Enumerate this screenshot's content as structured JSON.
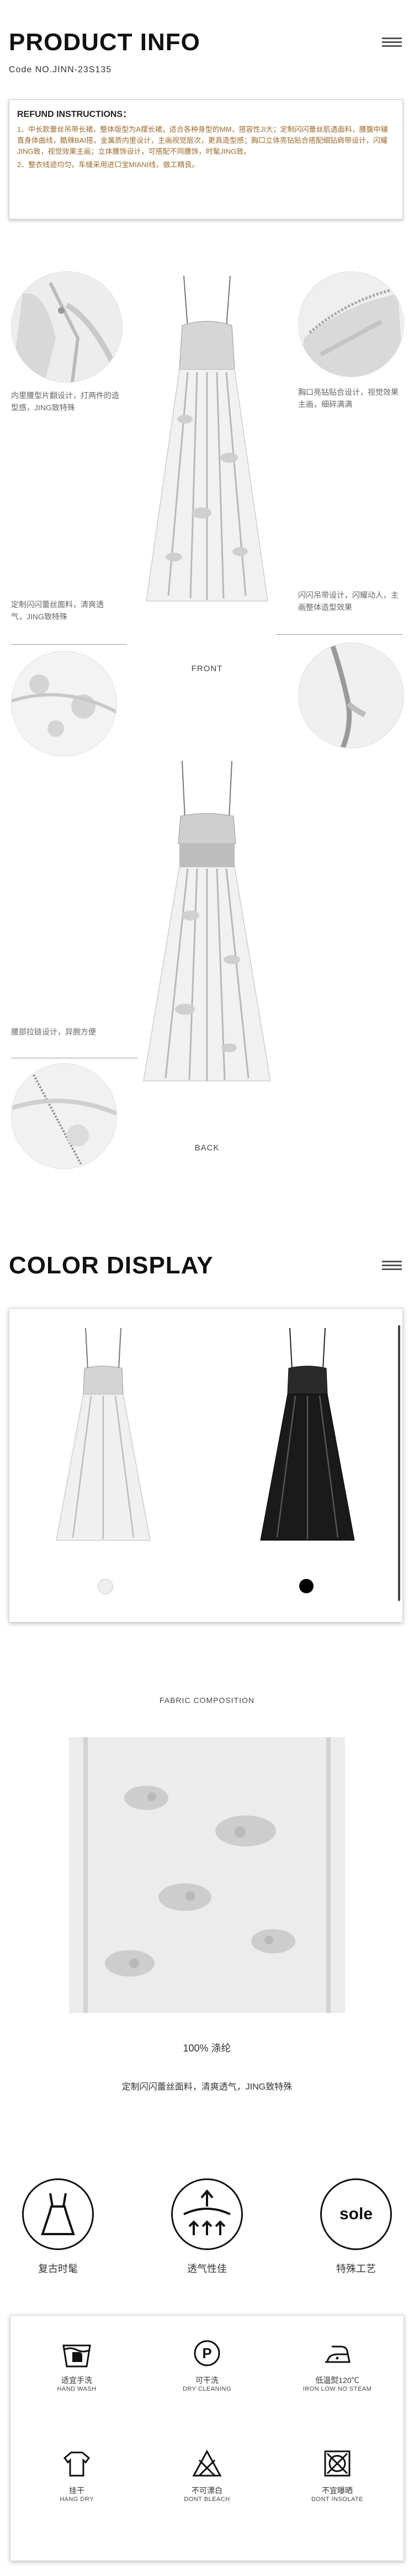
{
  "product": {
    "section_title": "PRODUCT INFO",
    "code": "Code NO.JINN-23S135",
    "refund_title": "REFUND INSTRUCTIONS：",
    "refund_lines": [
      "1、中长款蕾丝吊带长裙，整体版型为A摆长裙，适合各种身型的MM，搭容性JI大；定制闪闪蕾丝肌透面料，腰腹中辅直身体曲线，酷辣BAI搭，金属质内里设计，主画视觉层次，更具造型感；胸口立体亮钻贴合搭配细钻肩带设计，闪耀JING致，视觉效果主画；立体腰饰设计，可搭配不同腰饰，时髦JING致。",
      "2、整衣线迹均匀，车缝采用进口宝MIANI线，做工精良。"
    ],
    "notes": {
      "top_left": "内里腰型片翻设计，打两件的造型感，JING致特殊",
      "top_right": "胸口亮钻贴合设计，视觉效果主画，细碎满满",
      "mid_left": "定制闪闪蕾丝面料，清爽透气，JING致特殊",
      "mid_right": "闪闪吊带设计，闪耀动人，主画整体造型效果",
      "back_left": "腰部拉链设计，异腕方便"
    },
    "front_label": "FRONT",
    "back_label": "BACK"
  },
  "color": {
    "section_title": "COLOR DISPLAY",
    "swatches": [
      {
        "name": "white",
        "hex": "#eeeeee"
      },
      {
        "name": "black",
        "hex": "#000000"
      }
    ]
  },
  "fabric": {
    "heading": "FABRIC COMPOSITION",
    "composition": "100% 涤纶",
    "description": "定制闪闪蕾丝面料，清爽透气，JING致特殊"
  },
  "features": [
    {
      "label": "复古时髦",
      "icon": "dress-icon"
    },
    {
      "label": "透气性佳",
      "icon": "breathable-icon"
    },
    {
      "label": "特殊工艺",
      "icon": "sole-icon",
      "icon_text": "sole"
    }
  ],
  "care": [
    {
      "cn": "适宜手洗",
      "en": "HAND WASH",
      "icon": "hand-wash-icon"
    },
    {
      "cn": "可干洗",
      "en": "DRY CLEANING",
      "icon": "dry-clean-icon",
      "glyph": "P"
    },
    {
      "cn": "低温熨120℃",
      "en": "IRON LOW NO STEAM",
      "icon": "iron-icon"
    },
    {
      "cn": "挂干",
      "en": "HANG DRY",
      "icon": "hang-dry-icon"
    },
    {
      "cn": "不可漂白",
      "en": "DONT BLEACH",
      "icon": "no-bleach-icon"
    },
    {
      "cn": "不宜曝晒",
      "en": "DONT INSOLATE",
      "icon": "no-sun-icon"
    }
  ],
  "colors": {
    "text_dark": "#111111",
    "refund_text": "#9a6a2a",
    "note": "#666666"
  }
}
